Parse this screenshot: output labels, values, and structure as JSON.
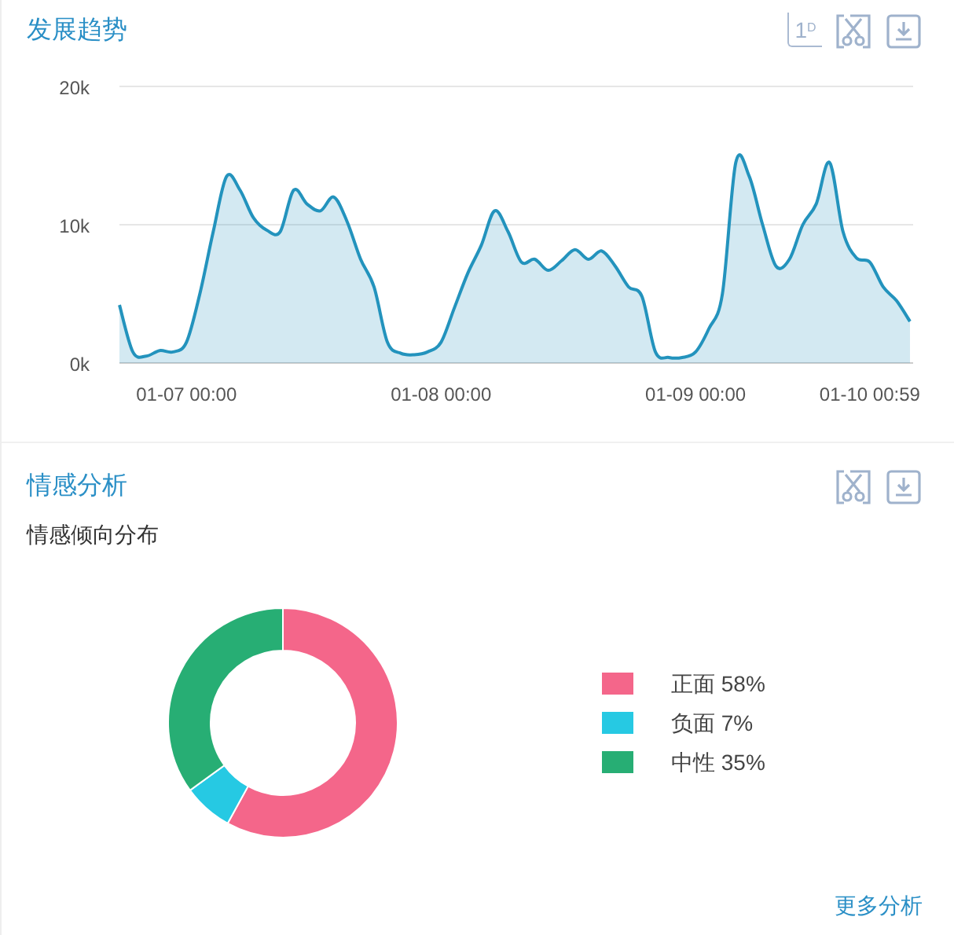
{
  "trend_panel": {
    "title": "发展趋势",
    "tools": [
      {
        "kind": "toggle",
        "label": "1$^{D}$"
      },
      {
        "kind": "crop"
      },
      {
        "kind": "download"
      }
    ],
    "chart_data": {
      "type": "area",
      "categories": [
        null,
        null,
        null,
        null,
        null,
        "01-07 00:00",
        null,
        null,
        null,
        null,
        null,
        null,
        null,
        null,
        null,
        null,
        null,
        null,
        null,
        null,
        null,
        null,
        null,
        null,
        "01-08 00:00",
        null,
        null,
        null,
        null,
        null,
        null,
        null,
        null,
        null,
        null,
        null,
        null,
        null,
        null,
        null,
        null,
        null,
        null,
        "01-09 00:00",
        null,
        null,
        null,
        null,
        null,
        null,
        null,
        null,
        null,
        null,
        null,
        null,
        "01-10 00:59",
        null,
        null,
        null
      ],
      "series": [
        {
          "color": "#2393bd",
          "values": [
            4200,
            800,
            500,
            900,
            800,
            1500,
            5000,
            9500,
            13500,
            12500,
            10500,
            9600,
            9500,
            12500,
            11500,
            11000,
            12000,
            10200,
            7500,
            5500,
            1500,
            700,
            600,
            800,
            1500,
            4000,
            6500,
            8500,
            11000,
            9500,
            7300,
            7500,
            6700,
            7400,
            8200,
            7500,
            8100,
            7000,
            5500,
            4800,
            800,
            400,
            400,
            800,
            2500,
            5000,
            14500,
            13500,
            10000,
            7000,
            7500,
            10000,
            11500,
            14500,
            9500,
            7600,
            7300,
            5500,
            4500,
            3000
          ]
        }
      ],
      "ylim": [
        0,
        20000
      ],
      "yticks": [
        {
          "value": 0,
          "label": "0k"
        },
        {
          "value": 10000,
          "label": "10k"
        },
        {
          "value": 20000,
          "label": "20k"
        }
      ]
    }
  },
  "sentiment_panel": {
    "title": "情感分析",
    "tools": [
      {
        "kind": "crop"
      },
      {
        "kind": "download"
      }
    ],
    "subtitle": "情感倾向分布",
    "chart_data": {
      "type": "donut",
      "categories": [
        "正面",
        "负面",
        "中性"
      ],
      "values": [
        58,
        7,
        35
      ],
      "value_labels": [
        "58%",
        "7%",
        "35%"
      ]
    },
    "legend": [
      {
        "color": "#f4668a"
      },
      {
        "color": "#26c9e3"
      },
      {
        "color": "#27ae74"
      }
    ],
    "more_link": "更多分析"
  }
}
